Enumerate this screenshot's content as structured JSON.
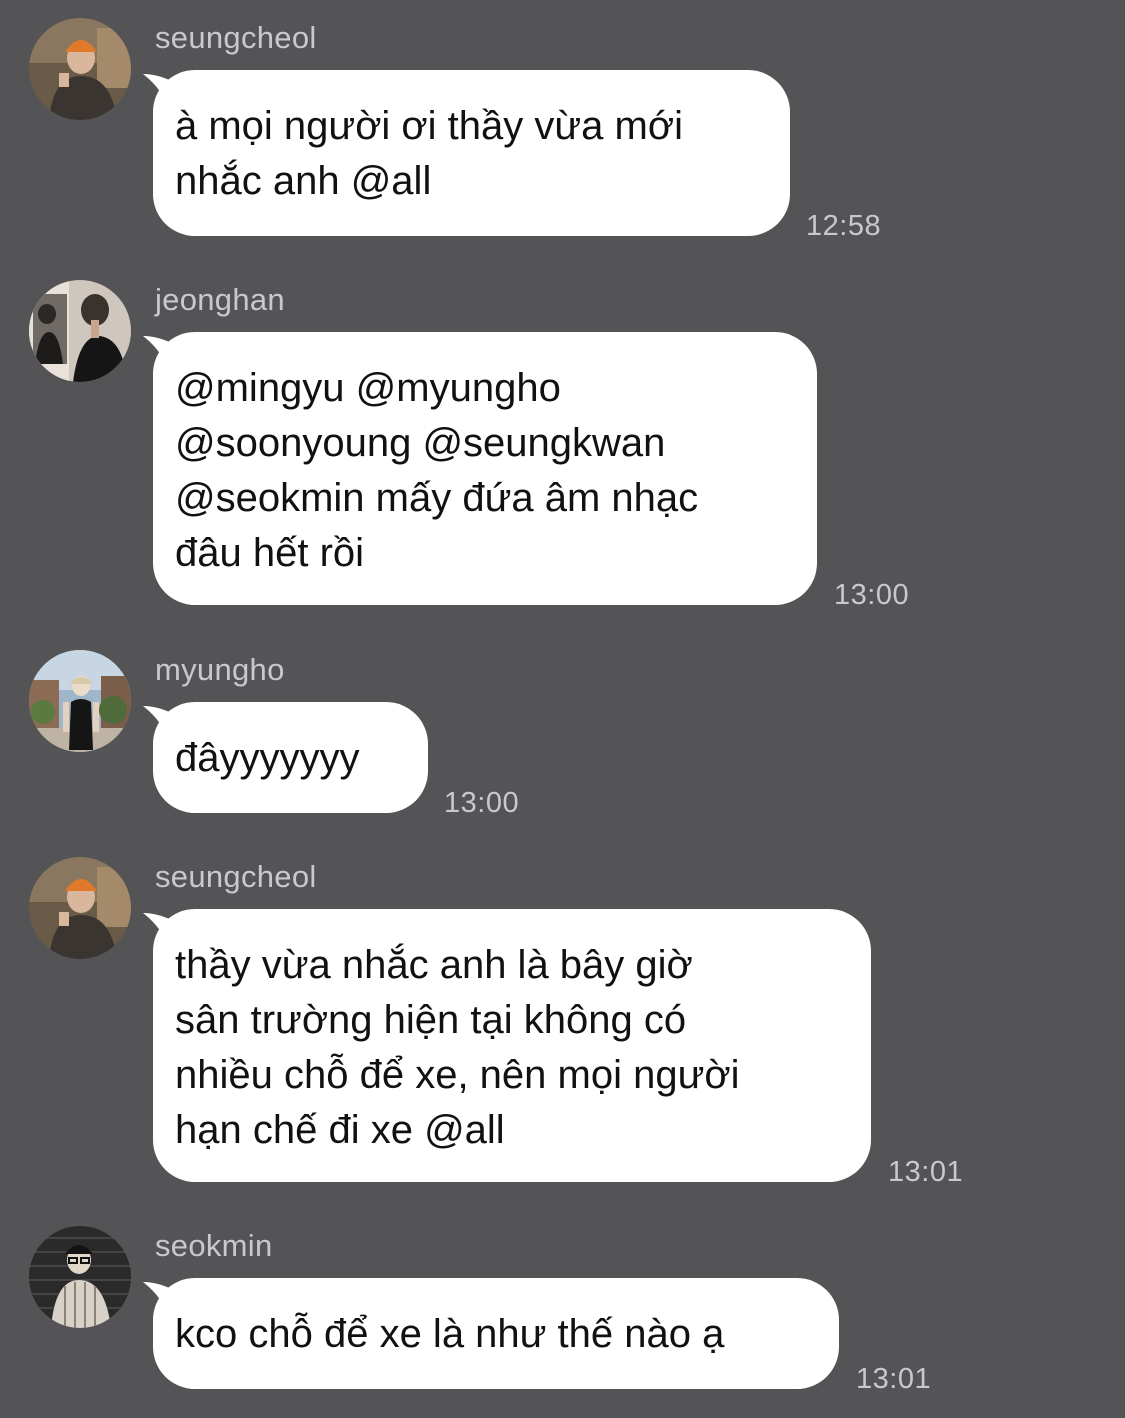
{
  "colors": {
    "background": "#545356",
    "bubble": "#ffffff",
    "meta_text": "#c9c8cc",
    "message_text": "#111111"
  },
  "messages": [
    {
      "sender": "seungcheol",
      "avatar_icon": "avatar-seungcheol",
      "text": "à mọi người ơi thầy vừa mới\nnhắc anh @all",
      "time": "12:58"
    },
    {
      "sender": "jeonghan",
      "avatar_icon": "avatar-jeonghan",
      "text": "@mingyu @myungho\n@soonyoung @seungkwan\n@seokmin mấy đứa âm nhạc\nđâu hết rồi",
      "time": "13:00"
    },
    {
      "sender": "myungho",
      "avatar_icon": "avatar-myungho",
      "text": "đâyyyyyyy",
      "time": "13:00"
    },
    {
      "sender": "seungcheol",
      "avatar_icon": "avatar-seungcheol",
      "text": "thầy vừa nhắc anh là bây giờ\nsân trường hiện tại không có\nnhiều chỗ để xe, nên mọi người\nhạn chế đi xe @all",
      "time": "13:01"
    },
    {
      "sender": "seokmin",
      "avatar_icon": "avatar-seokmin",
      "text": "kco chỗ để xe là như thế nào ạ",
      "time": "13:01"
    }
  ]
}
